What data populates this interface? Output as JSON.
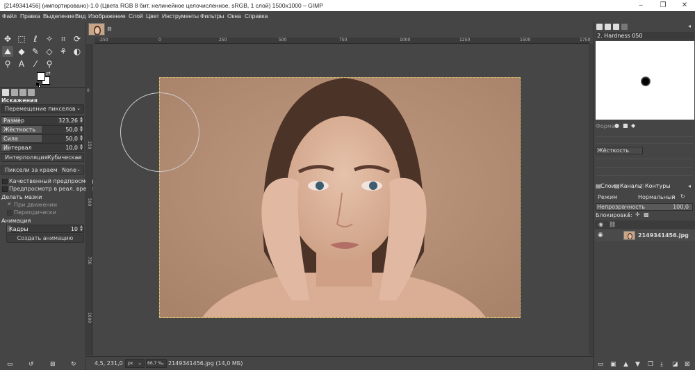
{
  "window": {
    "title": "[2149341456] (импортировано)-1.0 (Цвета RGB 8 бит, нелинейное целочисленное, sRGB, 1 слой) 1500x1000 – GIMP",
    "minimize": "–",
    "maximize": "❐",
    "close": "✕"
  },
  "menu": [
    "Файл",
    "Правка",
    "Выделение",
    "Вид",
    "Изображение",
    "Слой",
    "Цвет",
    "Инструменты",
    "Фильтры",
    "Окна",
    "Справка"
  ],
  "tool_options": {
    "title": "Искажения",
    "mode": "Перемещение пикселов",
    "size": {
      "label": "Размер",
      "value": "323,26"
    },
    "hardness": {
      "label": "Жёсткость",
      "value": "50,0"
    },
    "strength": {
      "label": "Сила",
      "value": "50,0"
    },
    "spacing": {
      "label": "Интервал",
      "value": "10,0"
    },
    "interpolation": {
      "label": "Интерполяция",
      "value": "Кубическая"
    },
    "abyss": {
      "label": "Пиксели за краем",
      "value": "None"
    },
    "hq_preview": "Качественный предпросмотр",
    "realtime_preview": "Предпросмотр в реал. времени",
    "stroke_label": "Делать мазки",
    "during_motion": "При движении",
    "periodically": "Периодически",
    "animation_label": "Анимация",
    "frames": {
      "label": "Кадры",
      "value": "10"
    },
    "create_animation": "Создать анимацию"
  },
  "ruler": {
    "h_ticks": [
      "-250",
      "0",
      "250",
      "500",
      "750",
      "1000",
      "1250",
      "1500",
      "1750"
    ],
    "v_ticks": [
      "0",
      "250",
      "500",
      "750",
      "1000"
    ]
  },
  "status": {
    "coords": "4,5, 231,0",
    "unit": "px",
    "zoom": "66,7 %",
    "file": "2149341456.jpg (14,0 МБ)"
  },
  "brushes": {
    "name": "2. Hardness 050",
    "shape_label": "Форма:",
    "hardness_label": "Жёсткость"
  },
  "layers": {
    "tabs": [
      "Слои",
      "Каналы",
      "Контуры"
    ],
    "mode_label": "Режим",
    "mode_value": "Нормальный",
    "opacity_label": "Непрозрачность",
    "opacity_value": "100,0",
    "lock_label": "Блокировка:",
    "layer_name": "2149341456.jpg"
  }
}
